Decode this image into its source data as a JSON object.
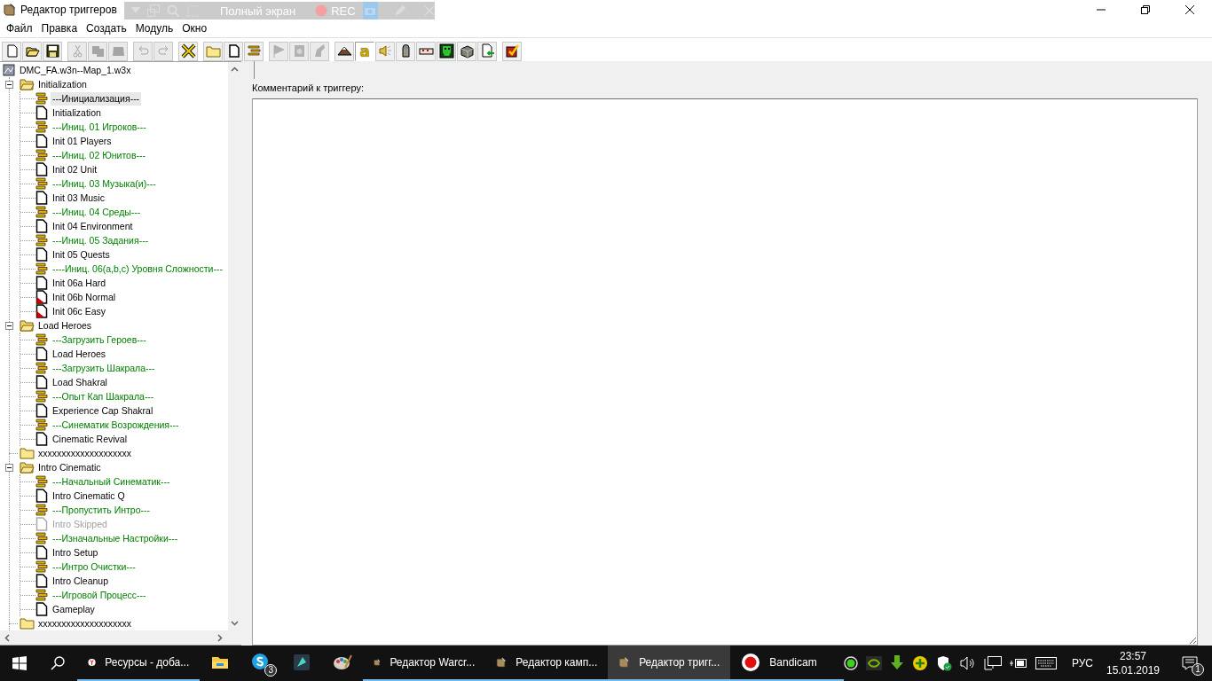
{
  "window": {
    "title": "Редактор триггеров"
  },
  "capture_bar": {
    "fullscreen_label": "Полный экран",
    "rec_label": "REC"
  },
  "menu": [
    "Файл",
    "Правка",
    "Создать",
    "Модуль",
    "Окно"
  ],
  "toolbar": [
    [
      {
        "kind": "new",
        "disabled": false,
        "selected": false
      },
      {
        "kind": "open",
        "disabled": false,
        "selected": false
      },
      {
        "kind": "save",
        "disabled": false,
        "selected": false
      }
    ],
    [
      {
        "kind": "cut",
        "disabled": true,
        "selected": false
      },
      {
        "kind": "copy",
        "disabled": true,
        "selected": false
      },
      {
        "kind": "paste",
        "disabled": true,
        "selected": false
      }
    ],
    [
      {
        "kind": "undo",
        "disabled": true,
        "selected": false
      },
      {
        "kind": "redo",
        "disabled": true,
        "selected": false
      }
    ],
    [
      {
        "kind": "delete",
        "disabled": false,
        "selected": false
      }
    ],
    [
      {
        "kind": "folder",
        "disabled": false,
        "selected": false
      },
      {
        "kind": "trigger",
        "disabled": false,
        "selected": false
      },
      {
        "kind": "comment",
        "disabled": false,
        "selected": false
      }
    ],
    [
      {
        "kind": "flag",
        "disabled": true,
        "selected": false
      },
      {
        "kind": "disk",
        "disabled": true,
        "selected": false
      },
      {
        "kind": "hand",
        "disabled": true,
        "selected": false
      }
    ],
    [
      {
        "kind": "terrain",
        "disabled": false,
        "selected": false
      },
      {
        "kind": "letter",
        "label": "a",
        "disabled": false,
        "selected": true
      },
      {
        "kind": "sound",
        "disabled": false,
        "selected": false
      },
      {
        "kind": "statue",
        "disabled": false,
        "selected": false
      },
      {
        "kind": "cards",
        "disabled": false,
        "selected": false
      },
      {
        "kind": "mask",
        "disabled": false,
        "selected": false
      },
      {
        "kind": "cube",
        "disabled": false,
        "selected": false
      },
      {
        "kind": "import",
        "disabled": false,
        "selected": false
      }
    ],
    [
      {
        "kind": "checklist",
        "disabled": false,
        "selected": false
      }
    ]
  ],
  "tree": {
    "root": "DMC_FA.w3n--Map_1.w3x",
    "folders": [
      {
        "label": "Initialization",
        "expanded": true,
        "children": [
          {
            "kind": "comment",
            "label": "---Инициализация---",
            "selected": true,
            "disabled": false
          },
          {
            "kind": "trigger",
            "label": "Initialization",
            "selected": false,
            "disabled": false
          },
          {
            "kind": "comment",
            "label": "---Иниц. 01 Игроков---",
            "selected": false,
            "disabled": false
          },
          {
            "kind": "trigger",
            "label": "Init 01 Players",
            "selected": false,
            "disabled": false
          },
          {
            "kind": "comment",
            "label": "---Иниц. 02 Юнитов---",
            "selected": false,
            "disabled": false
          },
          {
            "kind": "trigger",
            "label": "Init 02 Unit",
            "selected": false,
            "disabled": false
          },
          {
            "kind": "comment",
            "label": "---Иниц. 03 Музыка(и)---",
            "selected": false,
            "disabled": false
          },
          {
            "kind": "trigger",
            "label": "Init 03 Music",
            "selected": false,
            "disabled": false
          },
          {
            "kind": "comment",
            "label": "---Иниц. 04 Среды---",
            "selected": false,
            "disabled": false
          },
          {
            "kind": "trigger",
            "label": "Init 04 Environment",
            "selected": false,
            "disabled": false
          },
          {
            "kind": "comment",
            "label": "---Иниц. 05 Задания---",
            "selected": false,
            "disabled": false
          },
          {
            "kind": "trigger",
            "label": "Init 05 Quests",
            "selected": false,
            "disabled": false
          },
          {
            "kind": "comment",
            "label": "----Иниц. 06(a,b,c) Уровня Сложности---",
            "selected": false,
            "disabled": false
          },
          {
            "kind": "trigger",
            "label": "Init 06a Hard",
            "selected": false,
            "disabled": false
          },
          {
            "kind": "trigger-off",
            "label": "Init 06b Normal",
            "selected": false,
            "disabled": false
          },
          {
            "kind": "trigger-off",
            "label": "Init 06c Easy",
            "selected": false,
            "disabled": false
          }
        ]
      },
      {
        "label": "Load Heroes",
        "expanded": true,
        "children": [
          {
            "kind": "comment",
            "label": "---Загрузить Героев---",
            "selected": false,
            "disabled": false
          },
          {
            "kind": "trigger",
            "label": "Load Heroes",
            "selected": false,
            "disabled": false
          },
          {
            "kind": "comment",
            "label": "---Загрузить Шакрала---",
            "selected": false,
            "disabled": false
          },
          {
            "kind": "trigger",
            "label": "Load Shakral",
            "selected": false,
            "disabled": false
          },
          {
            "kind": "comment",
            "label": "---Опыт Кап Шакрала---",
            "selected": false,
            "disabled": false
          },
          {
            "kind": "trigger",
            "label": "Experience Cap Shakral",
            "selected": false,
            "disabled": false
          },
          {
            "kind": "comment",
            "label": "---Синематик Возрождения---",
            "selected": false,
            "disabled": false
          },
          {
            "kind": "trigger",
            "label": "Cinematic Revival",
            "selected": false,
            "disabled": false
          }
        ]
      },
      {
        "label": "xxxxxxxxxxxxxxxxxxxx",
        "expanded": false
      },
      {
        "label": "Intro Cinematic",
        "expanded": true,
        "children": [
          {
            "kind": "comment",
            "label": "---Начальный Синематик---",
            "selected": false,
            "disabled": false
          },
          {
            "kind": "trigger",
            "label": "Intro Cinematic Q",
            "selected": false,
            "disabled": false
          },
          {
            "kind": "comment",
            "label": "---Пропустить Интро---",
            "selected": false,
            "disabled": false
          },
          {
            "kind": "trigger",
            "label": "Intro Skipped",
            "selected": false,
            "disabled": true
          },
          {
            "kind": "comment",
            "label": "---Изначальные Настройки---",
            "selected": false,
            "disabled": false
          },
          {
            "kind": "trigger",
            "label": "Intro Setup",
            "selected": false,
            "disabled": false
          },
          {
            "kind": "comment",
            "label": "---Интро Очистки---",
            "selected": false,
            "disabled": false
          },
          {
            "kind": "trigger",
            "label": "Intro Cleanup",
            "selected": false,
            "disabled": false
          },
          {
            "kind": "comment",
            "label": "---Игровой Процесс---",
            "selected": false,
            "disabled": false
          },
          {
            "kind": "trigger",
            "label": "Gameplay",
            "selected": false,
            "disabled": false
          }
        ]
      },
      {
        "label": "xxxxxxxxxxxxxxxxxxxx",
        "expanded": false
      }
    ]
  },
  "comment_panel": {
    "label": "Комментарий к триггеру:"
  },
  "taskbar": {
    "apps": [
      {
        "kind": "browser",
        "label": "Ресурсы - доба...",
        "selected": false,
        "running": true
      },
      {
        "kind": "explorer",
        "selected": false,
        "running": false
      },
      {
        "kind": "skype",
        "badge": "3",
        "selected": false,
        "running": false
      },
      {
        "kind": "video",
        "selected": false,
        "running": false
      },
      {
        "kind": "paint",
        "selected": false,
        "running": false
      },
      {
        "kind": "editor",
        "label": "Редактор Warcr...",
        "selected": false,
        "running": true
      },
      {
        "kind": "editor",
        "label": "Редактор камп...",
        "selected": false,
        "running": true
      },
      {
        "kind": "editor",
        "label": "Редактор тригг...",
        "selected": true,
        "running": true
      },
      {
        "kind": "record",
        "label": "Bandicam",
        "selected": false,
        "running": true
      }
    ],
    "language": "РУС",
    "time": "23:57",
    "date": "15.01.2019",
    "notifications": "1"
  }
}
